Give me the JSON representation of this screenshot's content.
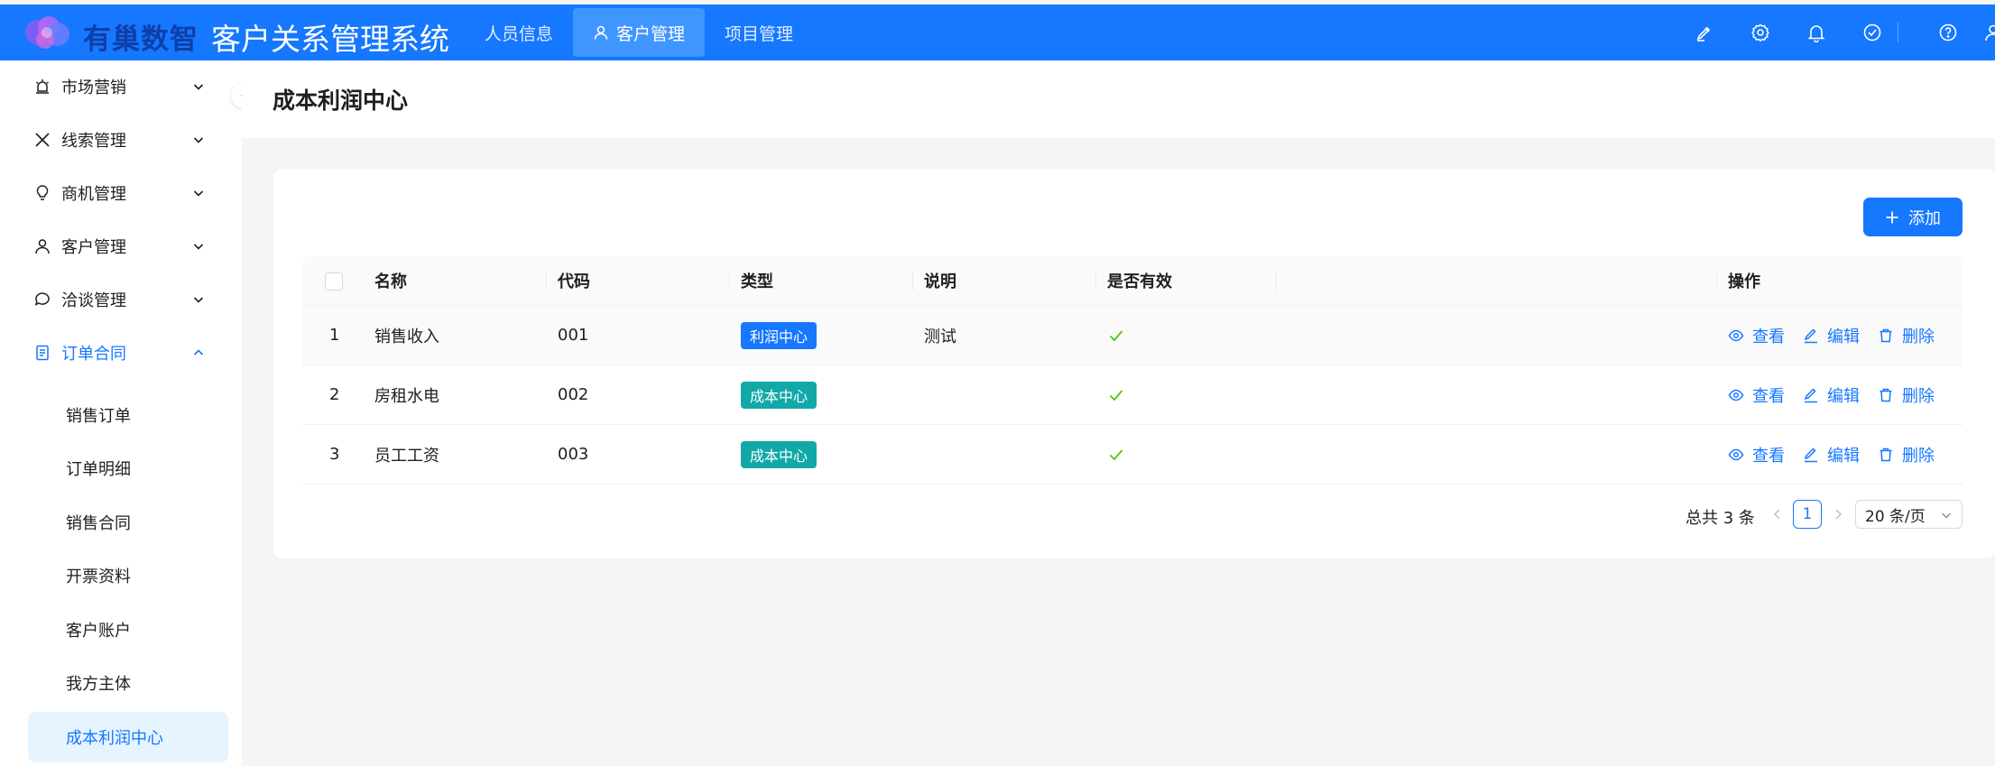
{
  "header": {
    "brand_text": "有巢数智",
    "app_title": "客户关系管理系统",
    "nav": [
      {
        "label": "人员信息"
      },
      {
        "label": "客户管理"
      },
      {
        "label": "项目管理"
      }
    ],
    "icons": [
      "pen-icon",
      "settings-icon",
      "bell-icon",
      "check-circle-icon",
      "help-icon",
      "user-icon"
    ]
  },
  "sidebar": {
    "menu": [
      {
        "label": "市场营销",
        "icon": "alarm-icon"
      },
      {
        "label": "线索管理",
        "icon": "x-icon"
      },
      {
        "label": "商机管理",
        "icon": "bulb-icon"
      },
      {
        "label": "客户管理",
        "icon": "user-icon"
      },
      {
        "label": "洽谈管理",
        "icon": "chat-icon"
      },
      {
        "label": "订单合同",
        "icon": "document-icon"
      }
    ],
    "submenu": [
      {
        "label": "销售订单"
      },
      {
        "label": "订单明细"
      },
      {
        "label": "销售合同"
      },
      {
        "label": "开票资料"
      },
      {
        "label": "客户账户"
      },
      {
        "label": "我方主体"
      },
      {
        "label": "成本利润中心"
      }
    ]
  },
  "page": {
    "title": "成本利润中心",
    "add_label": "添加"
  },
  "table": {
    "columns": [
      "名称",
      "代码",
      "类型",
      "说明",
      "是否有效",
      "操作"
    ],
    "rows": [
      {
        "index": "1",
        "name": "销售收入",
        "code": "001",
        "type": "利润中心",
        "desc": "测试",
        "valid": true
      },
      {
        "index": "2",
        "name": "房租水电",
        "code": "002",
        "type": "成本中心",
        "desc": "",
        "valid": true
      },
      {
        "index": "3",
        "name": "员工工资",
        "code": "003",
        "type": "成本中心",
        "desc": "",
        "valid": true
      }
    ],
    "actions": {
      "view": "查看",
      "edit": "编辑",
      "delete": "删除"
    }
  },
  "pagination": {
    "total_text": "总共 3 条",
    "current_page": "1",
    "page_size": "20 条/页"
  },
  "colors": {
    "primary": "#1677ff",
    "tag_profit": "#1677ff",
    "tag_cost": "#13a8a8",
    "valid_check": "#52c41a"
  }
}
